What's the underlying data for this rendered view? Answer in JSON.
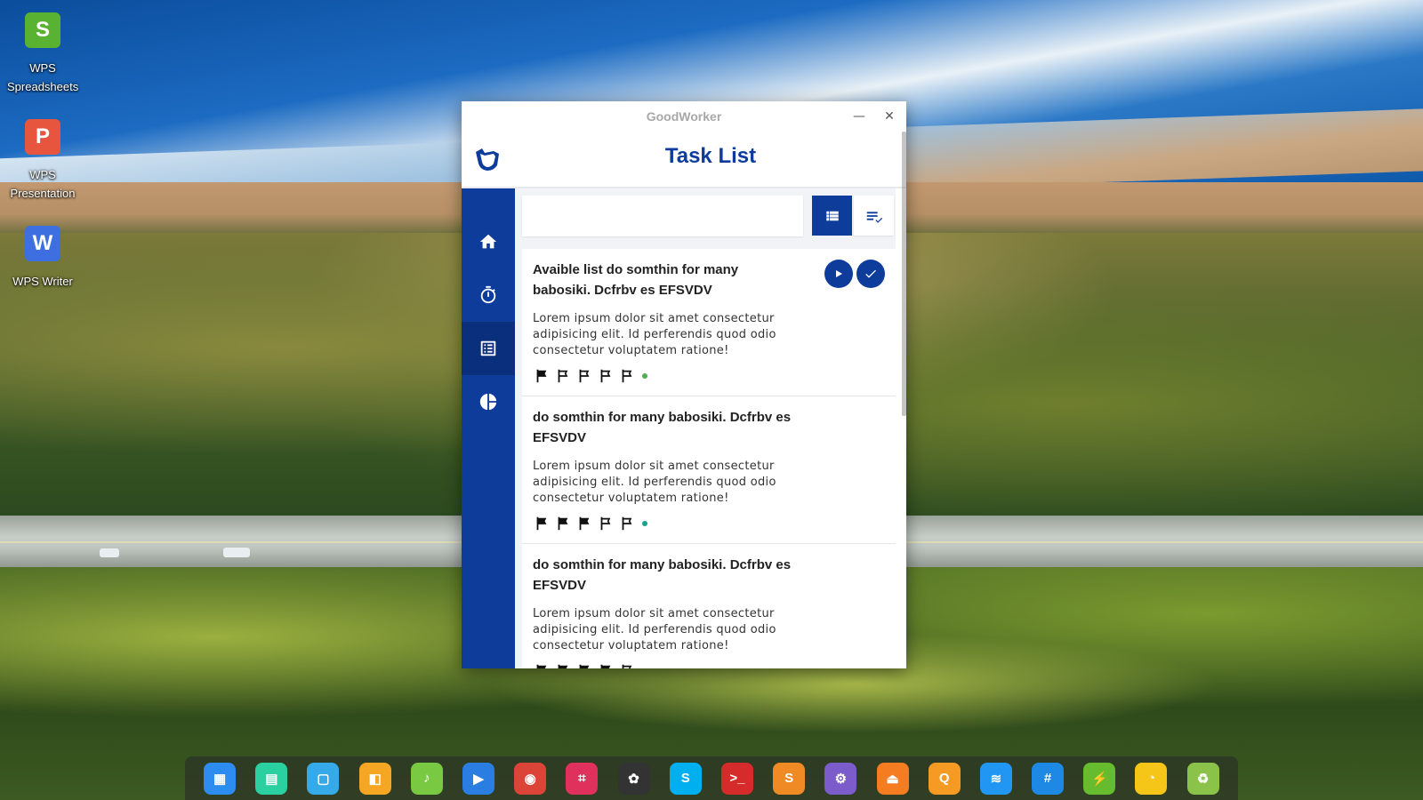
{
  "desktop": {
    "icons": [
      {
        "label": "WPS Spreadsheets",
        "color": "#5ab232",
        "glyph": "S"
      },
      {
        "label": "WPS Presentation",
        "color": "#e8553f",
        "glyph": "P"
      },
      {
        "label": "WPS Writer",
        "color": "#3d6fe0",
        "glyph": "W"
      }
    ]
  },
  "window": {
    "title": "GoodWorker",
    "minimize_glyph": "—",
    "close_glyph": "✕"
  },
  "app": {
    "heading": "Task List",
    "accent": "#0d3c9b",
    "nav": [
      {
        "name": "home-icon",
        "active": false
      },
      {
        "name": "stopwatch-icon",
        "active": false
      },
      {
        "name": "list-icon",
        "active": true
      },
      {
        "name": "pie-chart-icon",
        "active": false
      }
    ],
    "search": {
      "value": "",
      "placeholder": ""
    },
    "tasks": [
      {
        "title": "Avaible list do somthin for many babosiki. Dcfrbv es EFSVDV",
        "description": "Lorem ipsum dolor sit amet consectetur adipisicing elit. Id perferendis quod odio consectetur voluptatem ratione!",
        "priority_filled": 1,
        "priority_total": 5,
        "status_color": "#4caf50",
        "has_actions": true
      },
      {
        "title": "do somthin for many babosiki. Dcfrbv es EFSVDV",
        "description": "Lorem ipsum dolor sit amet consectetur adipisicing elit. Id perferendis quod odio consectetur voluptatem ratione!",
        "priority_filled": 3,
        "priority_total": 5,
        "status_color": "#17a589",
        "has_actions": false
      },
      {
        "title": "do somthin for many babosiki. Dcfrbv es EFSVDV",
        "description": "Lorem ipsum dolor sit amet consectetur adipisicing elit. Id perferendis quod odio consectetur voluptatem ratione!",
        "priority_filled": 4,
        "priority_total": 5,
        "status_color": "#e53935",
        "has_actions": false
      }
    ]
  },
  "dock": {
    "items": [
      {
        "name": "launcher-icon",
        "color": "#2d8cf0",
        "glyph": "▦"
      },
      {
        "name": "multitask-view-icon",
        "color": "#2bd0a0",
        "glyph": "▤"
      },
      {
        "name": "file-manager-icon",
        "color": "#36a9e8",
        "glyph": "▢"
      },
      {
        "name": "app-store-icon",
        "color": "#f5a623",
        "glyph": "◧"
      },
      {
        "name": "music-icon",
        "color": "#7ac943",
        "glyph": "♪"
      },
      {
        "name": "video-icon",
        "color": "#2a7de1",
        "glyph": "▶"
      },
      {
        "name": "chrome-icon",
        "color": "#db4437",
        "glyph": "◉"
      },
      {
        "name": "screenshot-icon",
        "color": "#e0315d",
        "glyph": "⌗"
      },
      {
        "name": "color-picker-icon",
        "color": "#333333",
        "glyph": "✿"
      },
      {
        "name": "skype-icon",
        "color": "#00aff0",
        "glyph": "S"
      },
      {
        "name": "terminal-icon",
        "color": "#d62b2b",
        "glyph": ">_"
      },
      {
        "name": "sublime-icon",
        "color": "#f08a24",
        "glyph": "S"
      },
      {
        "name": "settings-app-icon",
        "color": "#7c5ccb",
        "glyph": "⚙"
      },
      {
        "name": "installer-icon",
        "color": "#f57c20",
        "glyph": "⏏"
      },
      {
        "name": "browser-q-icon",
        "color": "#f59a23",
        "glyph": "Q"
      },
      {
        "name": "wifi-icon",
        "color": "#2196f3",
        "glyph": "≋"
      },
      {
        "name": "control-center-icon",
        "color": "#1e88e5",
        "glyph": "#"
      },
      {
        "name": "power-icon",
        "color": "#66bb2e",
        "glyph": "⚡"
      },
      {
        "name": "clock-icon",
        "color": "#f5c518",
        "glyph": "◔"
      },
      {
        "name": "trash-icon",
        "color": "#8bc34a",
        "glyph": "♻"
      }
    ]
  }
}
